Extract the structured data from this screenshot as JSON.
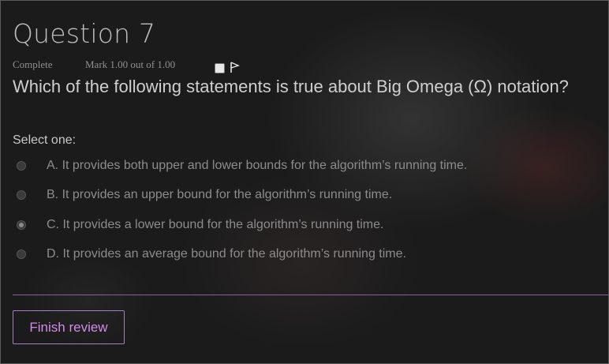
{
  "question": {
    "title": "Question 7",
    "state": "Complete",
    "grade": "Mark 1.00 out of 1.00",
    "text": "Which of the following statements is true about Big Omega (Ω) notation?",
    "prompt": "Select one:",
    "options": [
      {
        "label": "A. It provides both upper and lower bounds for the algorithm’s running time.",
        "selected": false
      },
      {
        "label": "B. It provides an upper bound for the algorithm’s running time.",
        "selected": false
      },
      {
        "label": "C. It provides a lower bound for the algorithm’s running time.",
        "selected": true
      },
      {
        "label": "D. It provides an average bound for the algorithm’s running time.",
        "selected": false
      }
    ]
  },
  "flag_icon": "flag-icon",
  "footer": {
    "finish_label": "Finish review"
  },
  "colors": {
    "accent": "#d08ce8",
    "divider": "#8a5fa0"
  }
}
